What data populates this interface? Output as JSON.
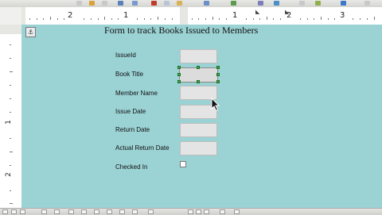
{
  "ruler": {
    "horizontal_numbers": [
      "2",
      "1",
      "1",
      "2",
      "3"
    ],
    "vertical_numbers": [
      "1",
      "2"
    ]
  },
  "form": {
    "title": "Form to track Books Issued to Members",
    "fields": [
      {
        "label": "IssueId"
      },
      {
        "label": "Book Title"
      },
      {
        "label": "Member Name"
      },
      {
        "label": "Issue Date"
      },
      {
        "label": "Return Date"
      },
      {
        "label": "Actual Return Date"
      }
    ],
    "checkbox_label": "Checked In"
  },
  "icons": {
    "anchor": "anchor-icon",
    "cursor": "arrow-cursor-icon"
  },
  "colors": {
    "form_background": "#9bd2d4",
    "field_background": "#e4e4e4",
    "selection_handle": "#3db34a"
  }
}
